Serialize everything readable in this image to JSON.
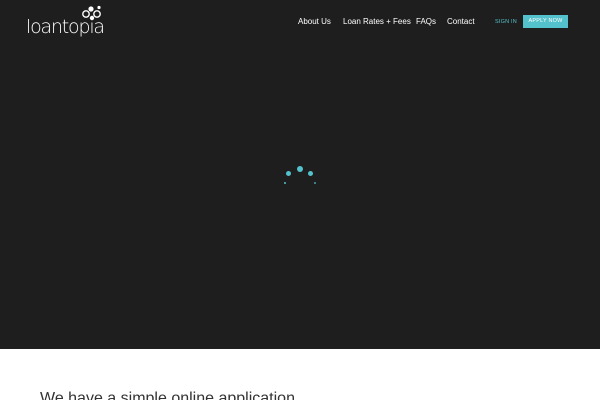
{
  "brand": {
    "logo_text": "loantopia",
    "logo_icon": "bubbles-icon"
  },
  "nav": {
    "items": [
      {
        "label": "About Us"
      },
      {
        "label": "Loan Rates + Fees"
      },
      {
        "label": "FAQs"
      },
      {
        "label": "Contact"
      }
    ],
    "sign_in": "SIGN IN",
    "apply_now": "APPLY NOW"
  },
  "hero": {
    "loader_icon": "loading-spinner-icon"
  },
  "intro": {
    "heading": "We have a simple online application"
  },
  "colors": {
    "accent": "#54c2cc",
    "hero_bg": "#1e1e1e",
    "text_light": "#ffffff",
    "text_dark": "#333333"
  }
}
